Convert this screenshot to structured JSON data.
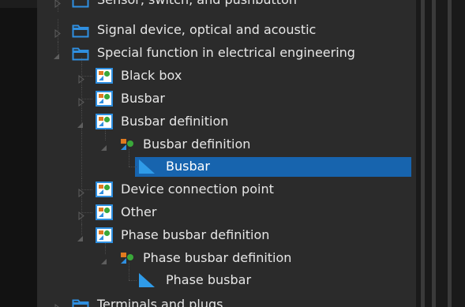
{
  "tree": {
    "items": [
      {
        "label": "Sensor, switch, and pushbutton",
        "icon": "folder-icon",
        "expander": "collapsed"
      },
      {
        "label": "Signal device, optical and acoustic",
        "icon": "folder-icon",
        "expander": "collapsed"
      },
      {
        "label": "Special function in electrical engineering",
        "icon": "folder-icon",
        "expander": "expanded"
      },
      {
        "label": "Black box",
        "icon": "symbol-group-icon",
        "expander": "collapsed"
      },
      {
        "label": "Busbar",
        "icon": "symbol-group-icon",
        "expander": "collapsed"
      },
      {
        "label": "Busbar definition",
        "icon": "symbol-group-icon",
        "expander": "expanded"
      },
      {
        "label": "Busbar definition",
        "icon": "symbol-subgroup-icon",
        "expander": "expanded"
      },
      {
        "label": "Busbar",
        "icon": "symbol-triangle-icon",
        "expander": "none",
        "selected": true
      },
      {
        "label": "Device connection point",
        "icon": "symbol-group-icon",
        "expander": "collapsed"
      },
      {
        "label": "Other",
        "icon": "symbol-group-icon",
        "expander": "collapsed"
      },
      {
        "label": "Phase busbar definition",
        "icon": "symbol-group-icon",
        "expander": "expanded"
      },
      {
        "label": "Phase busbar definition",
        "icon": "symbol-subgroup-icon",
        "expander": "expanded"
      },
      {
        "label": "Phase busbar",
        "icon": "symbol-triangle-icon",
        "expander": "none"
      },
      {
        "label": "Terminals and plugs",
        "icon": "folder-icon",
        "expander": "collapsed"
      }
    ]
  },
  "colors": {
    "selection": "#1764ae",
    "tree_background": "#2b2b2b",
    "text": "#e6e6e6"
  }
}
